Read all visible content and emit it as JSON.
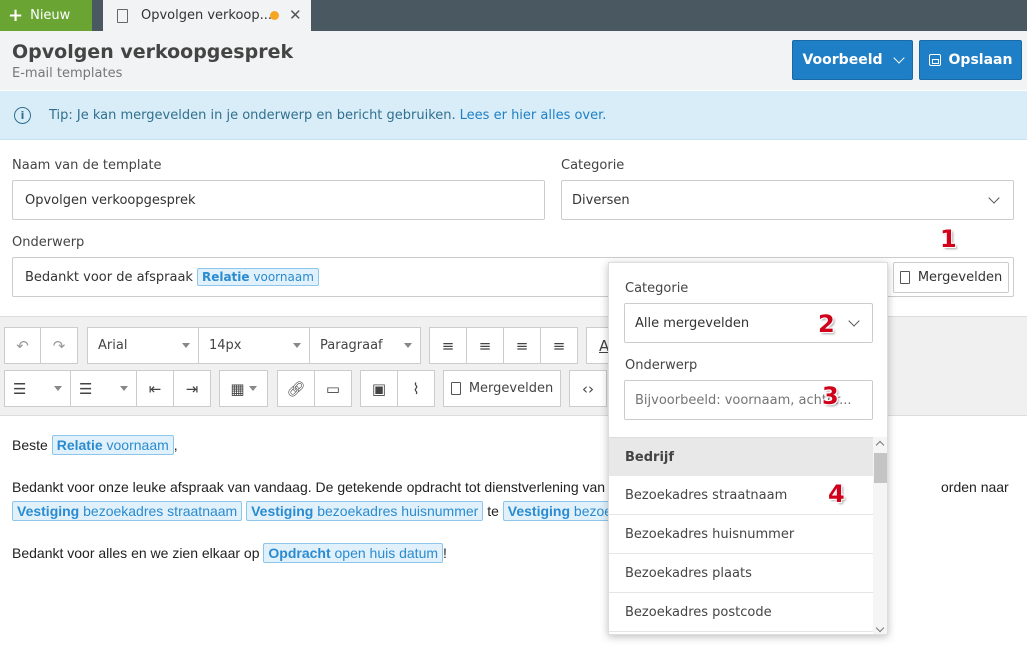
{
  "tabbar": {
    "new_label": "Nieuw",
    "doc_tab_label": "Opvolgen verkoop...",
    "doc_tab_close": "✕"
  },
  "header": {
    "title": "Opvolgen verkoopgesprek",
    "subtitle": "E-mail templates",
    "preview_label": "Voorbeeld",
    "save_label": "Opslaan"
  },
  "tip": {
    "text": "Tip: Je kan mergevelden in je onderwerp en bericht gebruiken.",
    "link": "Lees er hier alles over."
  },
  "form": {
    "name_label": "Naam van de template",
    "name_value": "Opvolgen verkoopgesprek",
    "category_label": "Categorie",
    "category_value": "Diversen",
    "subject_label": "Onderwerp",
    "subject_text": "Bedankt voor de afspraak",
    "subject_token_bold": "Relatie",
    "subject_token_rest": "voornaam",
    "merge_button": "Mergevelden"
  },
  "toolbar": {
    "font": "Arial",
    "size": "14px",
    "block": "Paragraaf",
    "merge_button": "Mergevelden"
  },
  "editor": {
    "p1_text": "Beste",
    "p1_token_bold": "Relatie",
    "p1_token_rest": "voornaam",
    "p1_after": ",",
    "p2_text": "Bedankt voor onze leuke afspraak van vandaag. De getekende opdracht tot dienstverlening van",
    "p2_tail": "orden naar",
    "p2_tok1_bold": "Vestiging",
    "p2_tok1_rest": "bezoekadres straatnaam",
    "p2_tok2_bold": "Vestiging",
    "p2_tok2_rest": "bezoekadres huisnummer",
    "p2_te": "te",
    "p2_tok3_bold": "Vestiging",
    "p2_tok3_rest": "bezoe",
    "p3_text": "Bedankt voor alles en we zien elkaar op",
    "p3_token_bold": "Opdracht",
    "p3_token_rest": "open huis datum",
    "p3_after": "!"
  },
  "popover": {
    "category_label": "Categorie",
    "category_value": "Alle mergevelden",
    "subject_label": "Onderwerp",
    "search_placeholder": "Bijvoorbeeld: voornaam, achter...",
    "group": "Bedrijf",
    "items": [
      "Bezoekadres straatnaam",
      "Bezoekadres huisnummer",
      "Bezoekadres plaats",
      "Bezoekadres postcode"
    ]
  },
  "annotations": [
    "1",
    "2",
    "3",
    "4"
  ],
  "colors": {
    "new_button": "#6aa534",
    "primary": "#1e7fc6",
    "tip_bg": "#d8edf7",
    "annotation": "#d0021b",
    "unsaved_dot": "#f5a623"
  }
}
